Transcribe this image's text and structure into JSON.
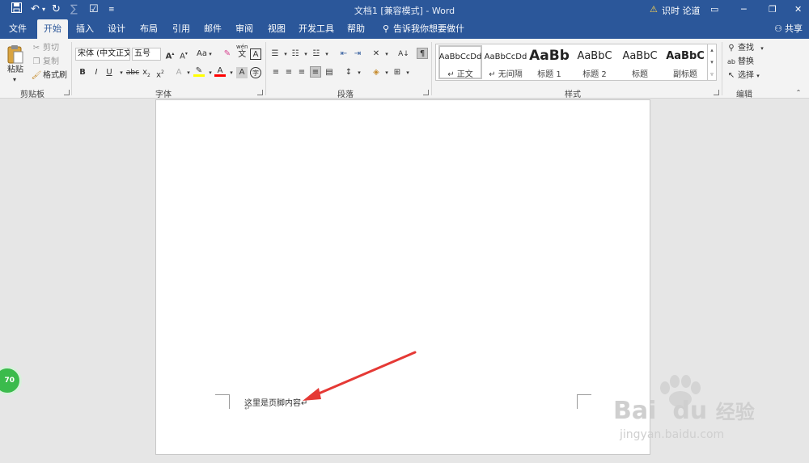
{
  "titlebar": {
    "doc_title": "文档1 [兼容模式] - Word",
    "user_label": "识时 论道"
  },
  "tabs": [
    {
      "label": "文件"
    },
    {
      "label": "开始"
    },
    {
      "label": "插入"
    },
    {
      "label": "设计"
    },
    {
      "label": "布局"
    },
    {
      "label": "引用"
    },
    {
      "label": "邮件"
    },
    {
      "label": "审阅"
    },
    {
      "label": "视图"
    },
    {
      "label": "开发工具"
    },
    {
      "label": "帮助"
    }
  ],
  "tell_me": "告诉我你想要做什么",
  "share": "共享",
  "clipboard": {
    "paste": "粘贴",
    "cut": "剪切",
    "copy": "复制",
    "format_painter": "格式刷",
    "group_label": "剪贴板"
  },
  "font": {
    "font_name": "宋体 (中文正文",
    "font_size": "五号",
    "group_label": "字体",
    "case_label": "Aa",
    "pinyin_top": "wén",
    "pinyin_bottom": "文",
    "strike_label": "abc",
    "border_char": "A",
    "enclose_char": "字"
  },
  "paragraph": {
    "group_label": "段落"
  },
  "styles": {
    "group_label": "样式",
    "items": [
      {
        "sample": "AaBbCcDd",
        "name": "↵ 正文"
      },
      {
        "sample": "AaBbCcDd",
        "name": "↵ 无间隔"
      },
      {
        "sample": "AaBb",
        "name": "标题 1"
      },
      {
        "sample": "AaBbC",
        "name": "标题 2"
      },
      {
        "sample": "AaBbC",
        "name": "标题"
      },
      {
        "sample": "AaBbC",
        "name": "副标题"
      }
    ]
  },
  "editing": {
    "find": "查找",
    "replace": "替换",
    "select": "选择",
    "group_label": "编辑"
  },
  "document": {
    "footer_text": "这里是页脚内容↵",
    "paragraph_mark": "↵"
  },
  "badge_value": "70",
  "watermark": {
    "brand": "Bai",
    "brand2": "du",
    "cn": "经验",
    "url": "jingyan.baidu.com"
  },
  "colors": {
    "accent": "#2b579a",
    "arrow": "#e53935",
    "highlight": "#ffff00",
    "font_color": "#ff0000"
  }
}
